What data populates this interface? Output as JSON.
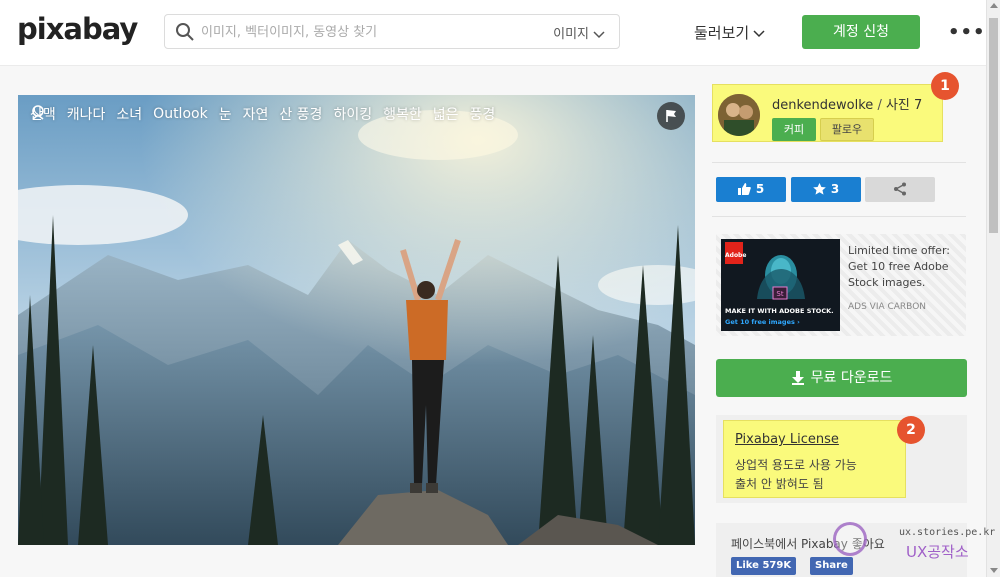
{
  "header": {
    "logo": "pixabay",
    "search_placeholder": "이미지, 벡터이미지, 동영상 찾기",
    "search_type": "이미지",
    "browse": "둘러보기",
    "join": "계정 신청",
    "more": "•••"
  },
  "photo": {
    "tags": [
      "산맥",
      "캐나다",
      "소녀",
      "Outlook",
      "눈",
      "자연",
      "산 풍경",
      "하이킹",
      "행복한",
      "넓은",
      "풍경"
    ]
  },
  "author": {
    "name": "denkendewolke",
    "separator": " / ",
    "photos": "사진 7",
    "coffee": "커피",
    "follow": "팔로우"
  },
  "stats": {
    "likes": "5",
    "favorites": "3"
  },
  "ad": {
    "text": "Limited time offer: Get 10 free Adobe Stock images.",
    "via": "ADS VIA CARBON",
    "adobe": "Adobe",
    "caption1": "MAKE IT WITH ADOBE STOCK.",
    "caption2": "Get 10 free images ›"
  },
  "download": "무료 다운로드",
  "license": {
    "title": "Pixabay License",
    "line1": "상업적 용도로 사용 가능",
    "line2": "출처 안 밝혀도 됨"
  },
  "facebook": {
    "text": "페이스북에서 Pixabay 좋아요",
    "like": "Like 579K",
    "share": "Share"
  },
  "badges": [
    "1",
    "2"
  ],
  "watermark": {
    "site": "ux.stories.pe.kr",
    "name": "UX공작소"
  },
  "colors": {
    "green": "#4bae4f",
    "blue": "#1a7fd1",
    "highlight": "#fafa7c",
    "badge": "#e6542f"
  }
}
